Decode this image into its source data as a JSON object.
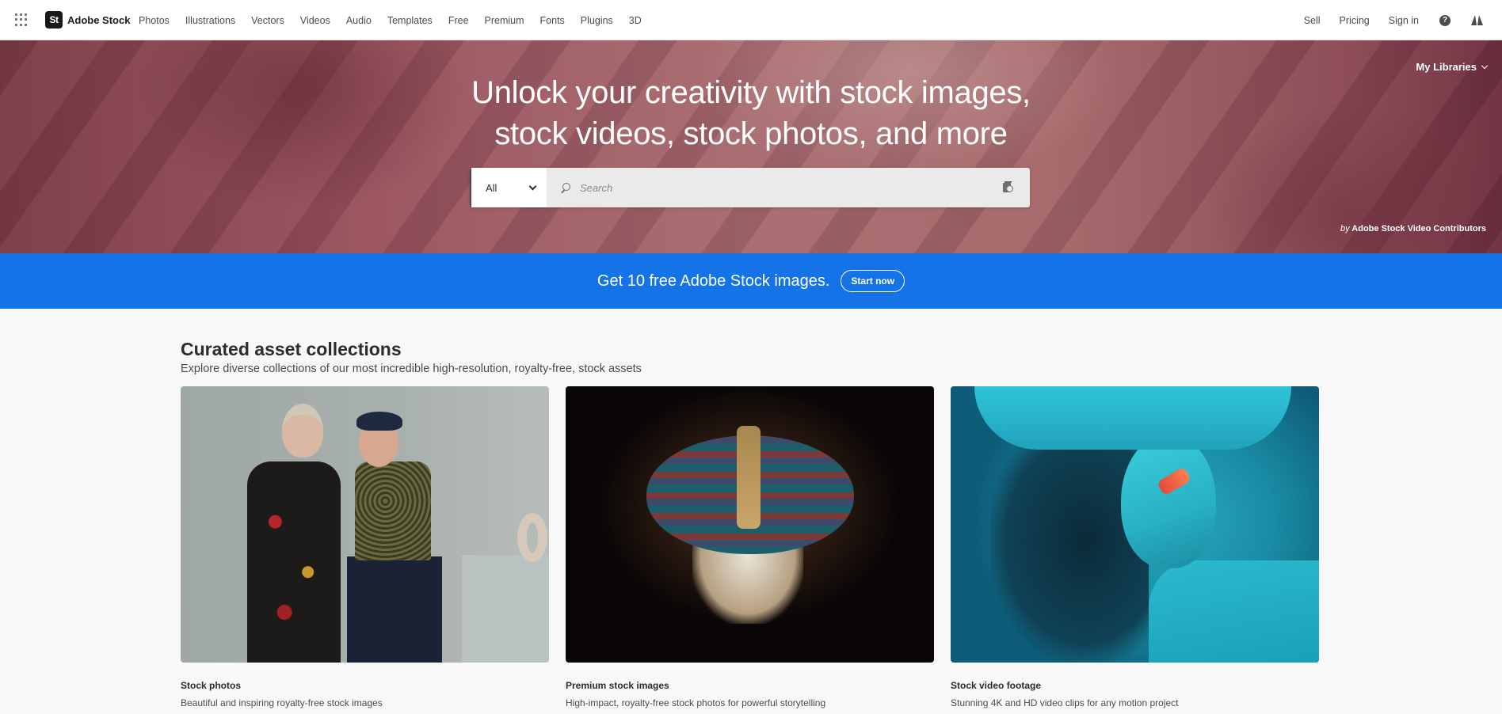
{
  "topnav": {
    "logo_badge": "St",
    "logo_text": "Adobe Stock",
    "links": [
      "Photos",
      "Illustrations",
      "Vectors",
      "Videos",
      "Audio",
      "Templates",
      "Free",
      "Premium",
      "Fonts",
      "Plugins",
      "3D"
    ],
    "right_links": [
      "Sell",
      "Pricing",
      "Sign in"
    ],
    "help_glyph": "?",
    "icons": [
      "apps-grid-icon",
      "help-icon",
      "adobe-logo-icon"
    ]
  },
  "hero": {
    "title_line1": "Unlock your creativity with stock images,",
    "title_line2": "stock videos, stock photos, and more",
    "search": {
      "type_selected": "All",
      "placeholder": "Search",
      "value": "",
      "icons": [
        "search-icon",
        "visual-search-icon",
        "chevron-down-icon"
      ]
    },
    "my_libraries": "My Libraries",
    "credit_prefix": "by",
    "credit_name": "Adobe Stock Video Contributors",
    "colors": {
      "overlay": "#9a5560"
    }
  },
  "promo": {
    "text": "Get 10 free Adobe Stock images.",
    "button": "Start now",
    "color": "#1473e6"
  },
  "section": {
    "title": "Curated asset collections",
    "subtitle": "Explore diverse collections of our most incredible high-resolution, royalty-free, stock assets",
    "cards": [
      {
        "title": "Stock photos",
        "description": "Beautiful and inspiring royalty-free stock images",
        "image": "two women in patterned clothing laughing"
      },
      {
        "title": "Premium stock images",
        "description": "High-impact, royalty-free stock photos for powerful storytelling",
        "image": "macro of a fly's compound eyes"
      },
      {
        "title": "Stock video footage",
        "description": "Stunning 4K and HD video clips for any motion project",
        "image": "woman with neon face paint in cyan light"
      }
    ]
  }
}
